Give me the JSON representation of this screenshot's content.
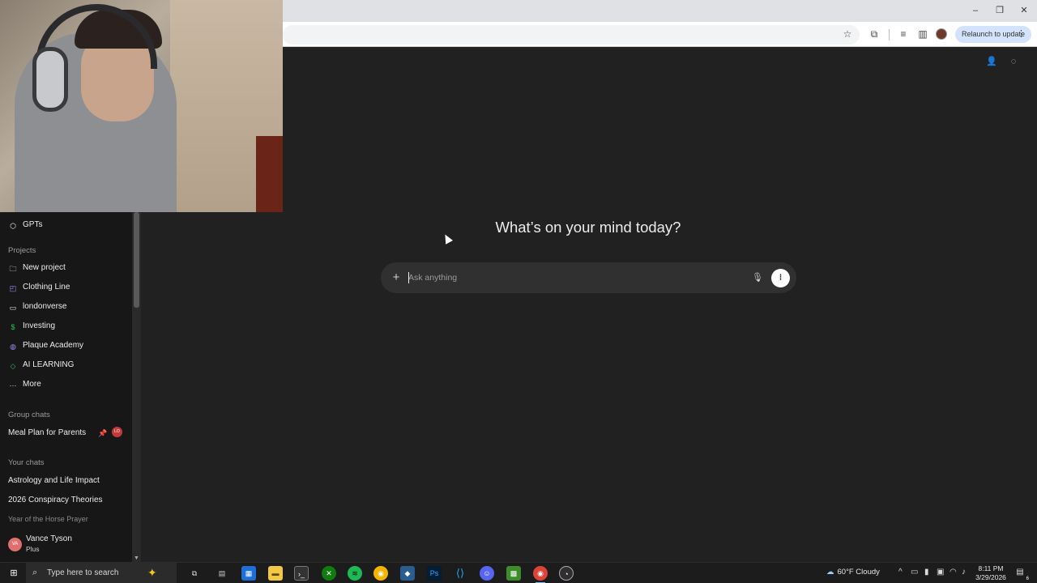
{
  "browser": {
    "relaunch_label": "Relaunch to update"
  },
  "sidebar": {
    "gpts_label": "GPTs",
    "projects_heading": "Projects",
    "projects": [
      {
        "label": "New project",
        "icon": "new-folder-icon"
      },
      {
        "label": "Clothing Line",
        "icon": "bag-icon",
        "color": "#a78bfa"
      },
      {
        "label": "londonverse",
        "icon": "folder-icon"
      },
      {
        "label": "Investing",
        "icon": "dollar-icon",
        "color": "#22c55e"
      },
      {
        "label": "Plaque Academy",
        "icon": "globe-icon",
        "color": "#a78bfa"
      },
      {
        "label": "AI LEARNING",
        "icon": "graduation-cap-icon",
        "color": "#22c55e"
      }
    ],
    "more_label": "More",
    "group_chats_heading": "Group chats",
    "group_chats": [
      {
        "label": "Meal Plan for Parents",
        "badge": "LO"
      }
    ],
    "your_chats_heading": "Your chats",
    "chats": [
      "Astrology and Life Impact",
      "2026 Conspiracy Theories",
      "Year of the Horse Prayer"
    ],
    "user": {
      "initials": "VA",
      "name": "Vance Tyson",
      "plan": "Plus"
    }
  },
  "main": {
    "headline": "What’s on your mind today?",
    "composer_placeholder": "Ask anything"
  },
  "taskbar": {
    "search_text": "Type here to search",
    "weather": "60°F  Cloudy",
    "time": "8:11 PM",
    "date": "3/29/2026",
    "notification_count": "6",
    "apps": [
      "task-view-icon",
      "file-explorer-icon",
      "ms-store-icon",
      "folder-icon",
      "terminal-icon",
      "xbox-icon",
      "spotify-icon",
      "chrome-icon",
      "davinci-icon",
      "photoshop-icon",
      "vscode-icon",
      "discord-icon",
      "minecraft-icon",
      "chrome-profile-icon",
      "obs-icon"
    ]
  }
}
